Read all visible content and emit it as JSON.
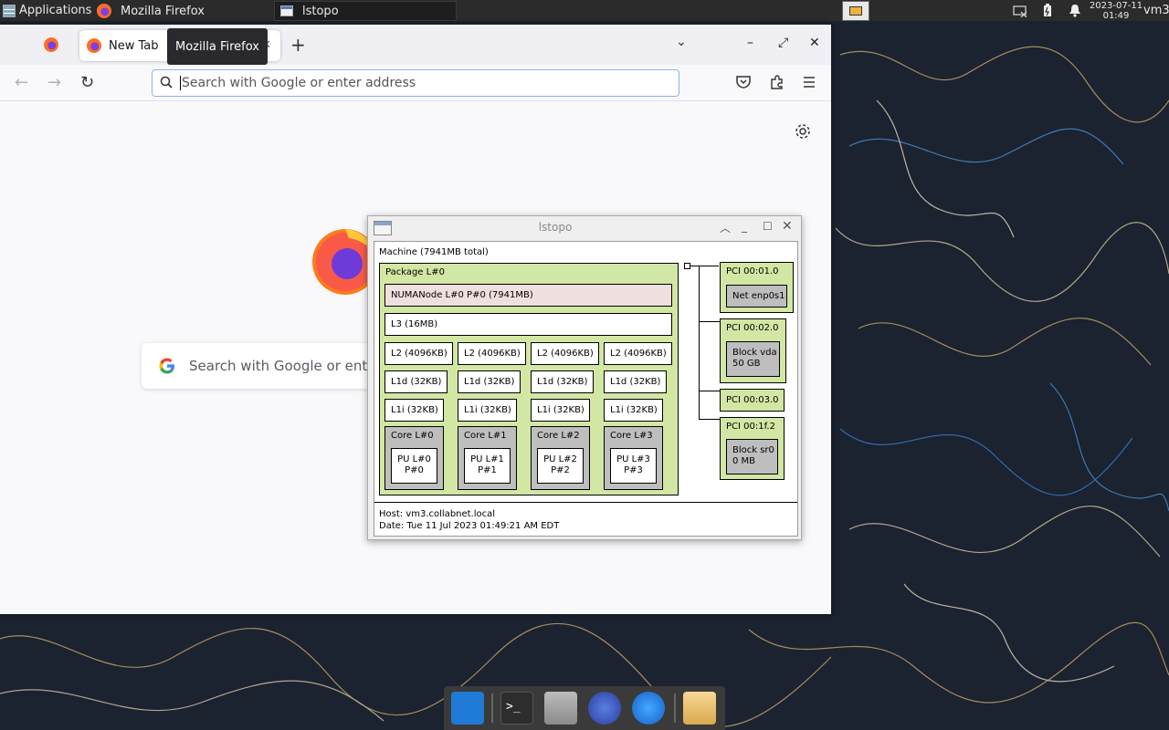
{
  "top_panel": {
    "applications_label": "Applications",
    "task_firefox_label": "Mozilla Firefox",
    "task_lstopo_label": "lstopo",
    "clock_date": "2023-07-11",
    "clock_time": "01:49",
    "user_label": "vm3"
  },
  "firefox": {
    "tab_label": "New Tab",
    "tooltip": "Mozilla Firefox",
    "url_placeholder": "Search with Google or enter address",
    "search_placeholder": "Search with Google or enter address"
  },
  "lstopo": {
    "title": "lstopo",
    "machine": "Machine (7941MB total)",
    "package": "Package L#0",
    "numa": "NUMANode L#0 P#0 (7941MB)",
    "l3": "L3 (16MB)",
    "l2": [
      "L2 (4096KB)",
      "L2 (4096KB)",
      "L2 (4096KB)",
      "L2 (4096KB)"
    ],
    "l1d": [
      "L1d (32KB)",
      "L1d (32KB)",
      "L1d (32KB)",
      "L1d (32KB)"
    ],
    "l1i": [
      "L1i (32KB)",
      "L1i (32KB)",
      "L1i (32KB)",
      "L1i (32KB)"
    ],
    "cores": [
      "Core L#0",
      "Core L#1",
      "Core L#2",
      "Core L#3"
    ],
    "pus": [
      {
        "l": "PU L#0",
        "p": "P#0"
      },
      {
        "l": "PU L#1",
        "p": "P#1"
      },
      {
        "l": "PU L#2",
        "p": "P#2"
      },
      {
        "l": "PU L#3",
        "p": "P#3"
      }
    ],
    "pci": [
      {
        "label": "PCI 00:01.0",
        "dev1": "Net enp0s1",
        "dev2": ""
      },
      {
        "label": "PCI 00:02.0",
        "dev1": "Block vda",
        "dev2": "50 GB"
      },
      {
        "label": "PCI 00:03.0",
        "dev1": "",
        "dev2": ""
      },
      {
        "label": "PCI 00:1f.2",
        "dev1": "Block sr0",
        "dev2": "0 MB"
      }
    ],
    "host": "Host: vm3.collabnet.local",
    "date": "Date: Tue 11 Jul 2023 01:49:21 AM EDT"
  },
  "colors": {
    "green": "#d2e7a4",
    "pink": "#efdfde",
    "gray": "#bebebe",
    "panel": "#2b2b2b"
  }
}
